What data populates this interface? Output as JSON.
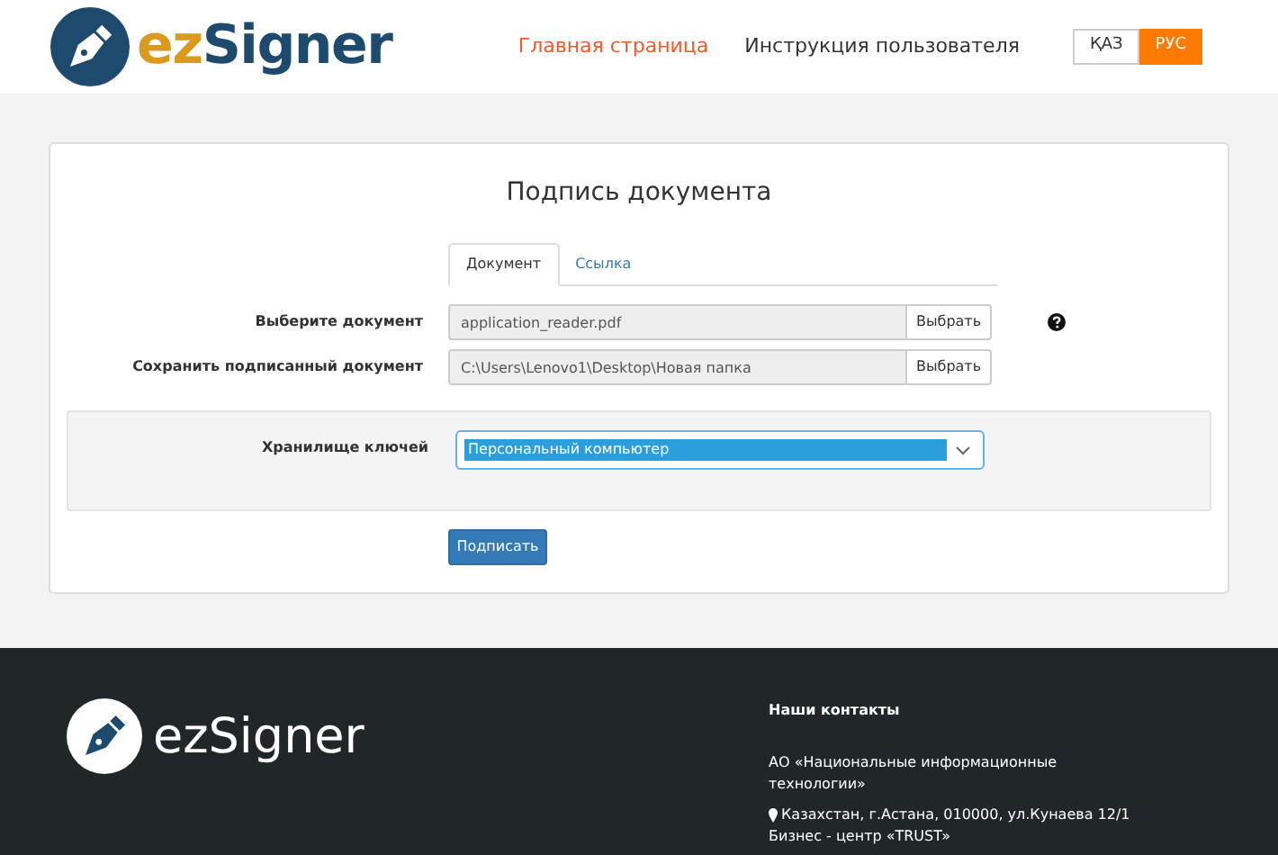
{
  "header": {
    "logo": {
      "prefix": "ez",
      "name": "Signer"
    },
    "nav": [
      {
        "label": "Главная страница",
        "selected": true
      },
      {
        "label": "Инструкция пользователя",
        "selected": false
      }
    ],
    "languages": [
      {
        "label": "ҚАЗ",
        "selected": false
      },
      {
        "label": "РУС",
        "selected": true
      }
    ]
  },
  "form": {
    "title": "Подпись документа",
    "tabs": [
      {
        "label": "Документ",
        "selected": true
      },
      {
        "label": "Ссылка",
        "selected": false
      }
    ],
    "fields": [
      {
        "label": "Выберите документ",
        "value": "application_reader.pdf",
        "button": "Выбрать",
        "help": true
      },
      {
        "label": "Сохранить подписанный документ",
        "value": "C:\\Users\\Lenovo1\\Desktop\\Новая папка",
        "button": "Выбрать",
        "help": false
      }
    ],
    "key_store": {
      "label": "Хранилище ключей",
      "value": "Персональный компьютер"
    },
    "submit": "Подписать"
  },
  "footer": {
    "logo": "ezSigner",
    "contacts_title": "Наши контакты",
    "organization": "АО «Национальные информационные технологии»",
    "address_lines": [
      "Казахстан, г.Астана, 010000, ул.Кунаева 12/1",
      "Бизнес - центр «TRUST»"
    ]
  }
}
